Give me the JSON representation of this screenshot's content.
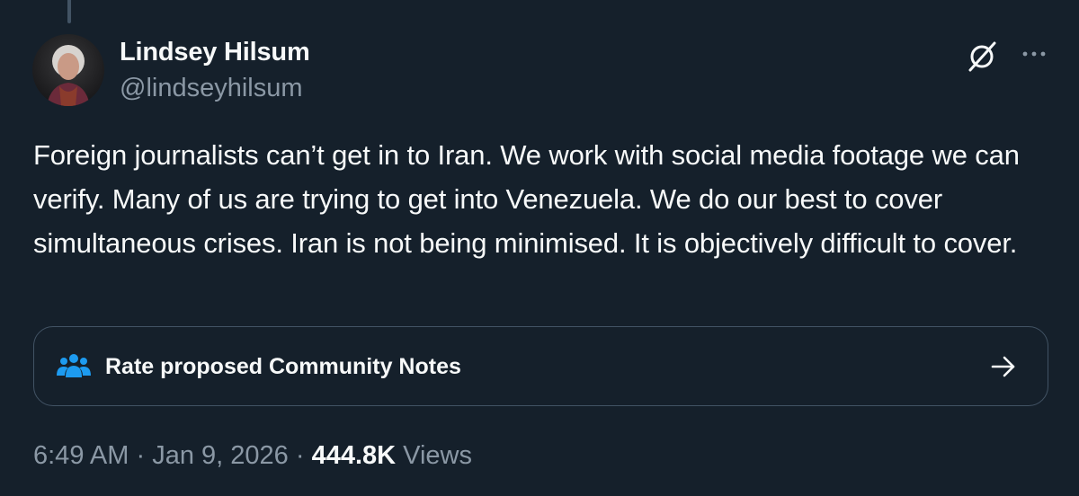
{
  "tweet": {
    "author": {
      "name": "Lindsey Hilsum",
      "handle": "@lindseyhilsum"
    },
    "text": "Foreign journalists can’t get in to Iran. We work with social media footage we can verify. Many of us are trying to get into Venezuela. We do our best to cover simultaneous crises. Iran is not being minimised. It is objectively difficult to cover.",
    "community_notes": {
      "label": "Rate proposed Community Notes",
      "icon": "people-icon",
      "icon_color": "#1d9bf0"
    },
    "meta": {
      "time": "6:49 AM",
      "separator": "·",
      "date": "Jan 9, 2026",
      "views_count": "444.8K",
      "views_label": "Views"
    },
    "header_icons": [
      "grok-icon",
      "more-icon"
    ]
  },
  "colors": {
    "background": "#15202b",
    "primary_text": "#f7f9f9",
    "secondary_text": "#8b98a5",
    "border": "#425364",
    "accent": "#1d9bf0"
  }
}
